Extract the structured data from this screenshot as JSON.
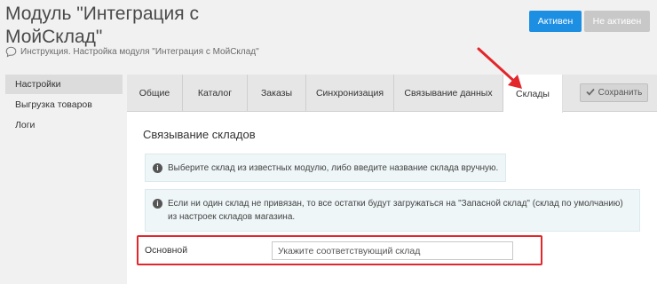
{
  "header": {
    "title": "Модуль \"Интеграция с МойСклад\"",
    "instruction": "Инструкция. Настройка модуля \"Интеграция с МойСклад\"",
    "active_label": "Активен",
    "inactive_label": "Не активен"
  },
  "sidebar": {
    "items": [
      {
        "label": "Настройки"
      },
      {
        "label": "Выгрузка товаров"
      },
      {
        "label": "Логи"
      }
    ]
  },
  "tabs": [
    {
      "label": "Общие"
    },
    {
      "label": "Каталог"
    },
    {
      "label": "Заказы"
    },
    {
      "label": "Синхронизация"
    },
    {
      "label": "Связывание данных"
    },
    {
      "label": "Склады"
    }
  ],
  "toolbar": {
    "save_label": "Сохранить"
  },
  "content": {
    "section_title": "Связывание складов",
    "info_1": "Выберите склад из известных модулю, либо введите название склада вручную.",
    "info_2": "Если ни один склад не привязан, то все остатки будут загружаться на \"Запасной склад\" (склад по умолчанию) из настроек складов магазина.",
    "field_label": "Основной",
    "field_placeholder": "Укажите соответствующий склад"
  },
  "colors": {
    "accent": "#1d8fe3",
    "highlight": "#e3262b"
  }
}
